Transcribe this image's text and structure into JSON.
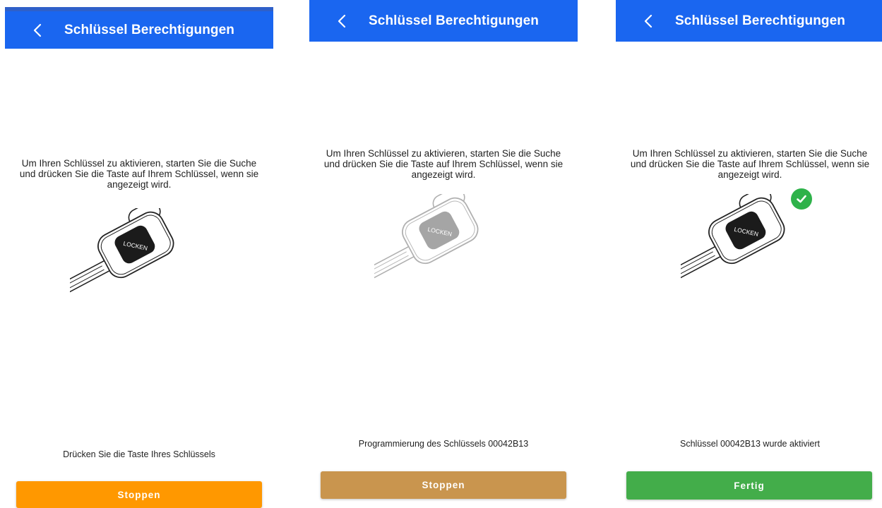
{
  "theme": {
    "header_color": "#1a66f0",
    "text_color": "#222222",
    "check_color": "#2eb24a"
  },
  "screens": [
    {
      "title": "Schlüssel Berechtigungen",
      "instruction": "Um Ihren Schlüssel zu aktivieren, starten Sie die Suche und drücken Sie die Taste auf Ihrem Schlüssel, wenn sie angezeigt wird.",
      "key_label": "LOCKEN",
      "key_state": "normal",
      "status": "Drücken Sie die Taste Ihres Schlüssels",
      "button_label": "Stoppen",
      "button_color": "#ff9800"
    },
    {
      "title": "Schlüssel Berechtigungen",
      "instruction": "Um Ihren Schlüssel zu aktivieren, starten Sie die Suche und drücken Sie die Taste auf Ihrem Schlüssel, wenn sie angezeigt wird.",
      "key_label": "LOCKEN",
      "key_state": "faded",
      "status": "Programmierung des Schlüssels 00042B13",
      "button_label": "Stoppen",
      "button_color": "#c9954e"
    },
    {
      "title": "Schlüssel Berechtigungen",
      "instruction": "Um Ihren Schlüssel zu aktivieren, starten Sie die Suche und drücken Sie die Taste auf Ihrem Schlüssel, wenn sie angezeigt wird.",
      "key_label": "LOCKEN",
      "key_state": "activated",
      "status": "Schlüssel 00042B13 wurde aktiviert",
      "button_label": "Fertig",
      "button_color": "#43ad4a"
    }
  ]
}
